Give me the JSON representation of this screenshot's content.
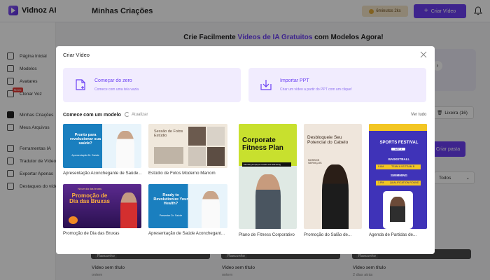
{
  "app": {
    "logo_text": "Vidnoz AI",
    "page_title": "Minhas Criações",
    "minutes": "6minutos 2ks",
    "create_button": "Criar Vídeo"
  },
  "sidebar": {
    "items": [
      {
        "label": "Página Inicial"
      },
      {
        "label": "Modelos"
      },
      {
        "label": "Avatares"
      },
      {
        "label": "Clonar Voz"
      },
      {
        "label": "Minhas Criações"
      },
      {
        "label": "Meus Arquivos"
      },
      {
        "label": "Ferramentas IA"
      },
      {
        "label": "Tradutor de Vídeo"
      },
      {
        "label": "Exportar Apenas"
      },
      {
        "label": "Destaques do vídeo"
      }
    ],
    "new_badge": "Novo"
  },
  "background": {
    "banner_prefix": "Crie Facilmente ",
    "banner_highlight": "Vídeos de IA Gratuitos",
    "banner_suffix": " com Modelos Agora!",
    "trash_label": "Lixeira (16)",
    "create_folder": "Criar pasta",
    "filter_value": "Todos",
    "cards": [
      {
        "tag": "Rascunho",
        "title": "Vídeo sem título",
        "sub": "ontem"
      },
      {
        "tag": "Rascunho",
        "title": "Vídeo sem título",
        "sub": "ontem"
      },
      {
        "tag": "Rascunho",
        "title": "Vídeo sem título",
        "sub": "2 dias atrás"
      }
    ]
  },
  "modal": {
    "title": "Criar Vídeo",
    "options": [
      {
        "title": "Começar do zero",
        "subtitle": "Comece com uma tela vazia"
      },
      {
        "title": "Importar PPT",
        "subtitle": "Criar um vídeo a partir do PPT com um clique!"
      }
    ],
    "section_label": "Comece com um modelo",
    "refresh_label": "Atualizar",
    "see_all": "Ver tudo",
    "templates": [
      {
        "label": "Apresentação Aconchegante de Saúde...",
        "thumb_title": "Pronto para revolucionar sua saúde?",
        "thumb_sub": "Apresentação Dr. Saúde"
      },
      {
        "label": "Estúdio de Fotos Moderno Marrom",
        "thumb_title": "Sessão de Fotos Estúdio",
        "thumb_sub": ""
      },
      {
        "label": "Plano de Fitness Corporativo",
        "thumb_title": "Corporate Fitness Plan",
        "thumb_sub": "Elevating Employee Health and Well-being"
      },
      {
        "label": "Promoção do Salão de...",
        "thumb_title": "Desbloqueie Seu Potencial do Cabelo",
        "thumb_sub": "NOSSOS SERVIÇOS"
      },
      {
        "label": "Agenda de Partidas de...",
        "thumb_title": "SPORTS FESTIVAL",
        "thumb_sub": "DAY 1",
        "events": [
          {
            "name": "BASKETBALL",
            "time": "9 AM",
            "teams": "TEAM A VS TEAM B"
          },
          {
            "name": "SWIMMING",
            "time": "1 PM",
            "teams": "QUALIFICATION ROUND"
          }
        ]
      },
      {
        "label": "Promoção de Dia das Bruxas",
        "thumb_title": "Promoção de Dia das Bruxas",
        "thumb_sub": "Há um dia das bruxas"
      },
      {
        "label": "Apresentação de Saúde Aconchegant...",
        "thumb_title": "Ready to Revolutionize Your Health?",
        "thumb_sub": "Presenter Dr. Saúde"
      }
    ]
  },
  "colors": {
    "accent": "#6b3ff3",
    "option_bg": "#f1ecfe",
    "overlay": "rgba(0,0,0,0.42)"
  },
  "icons": [
    "logo-icon",
    "coin-icon",
    "plus-icon",
    "bell-icon",
    "close-icon",
    "blank-canvas-icon",
    "ppt-import-icon",
    "refresh-icon",
    "trash-icon",
    "chevron-down-icon"
  ]
}
